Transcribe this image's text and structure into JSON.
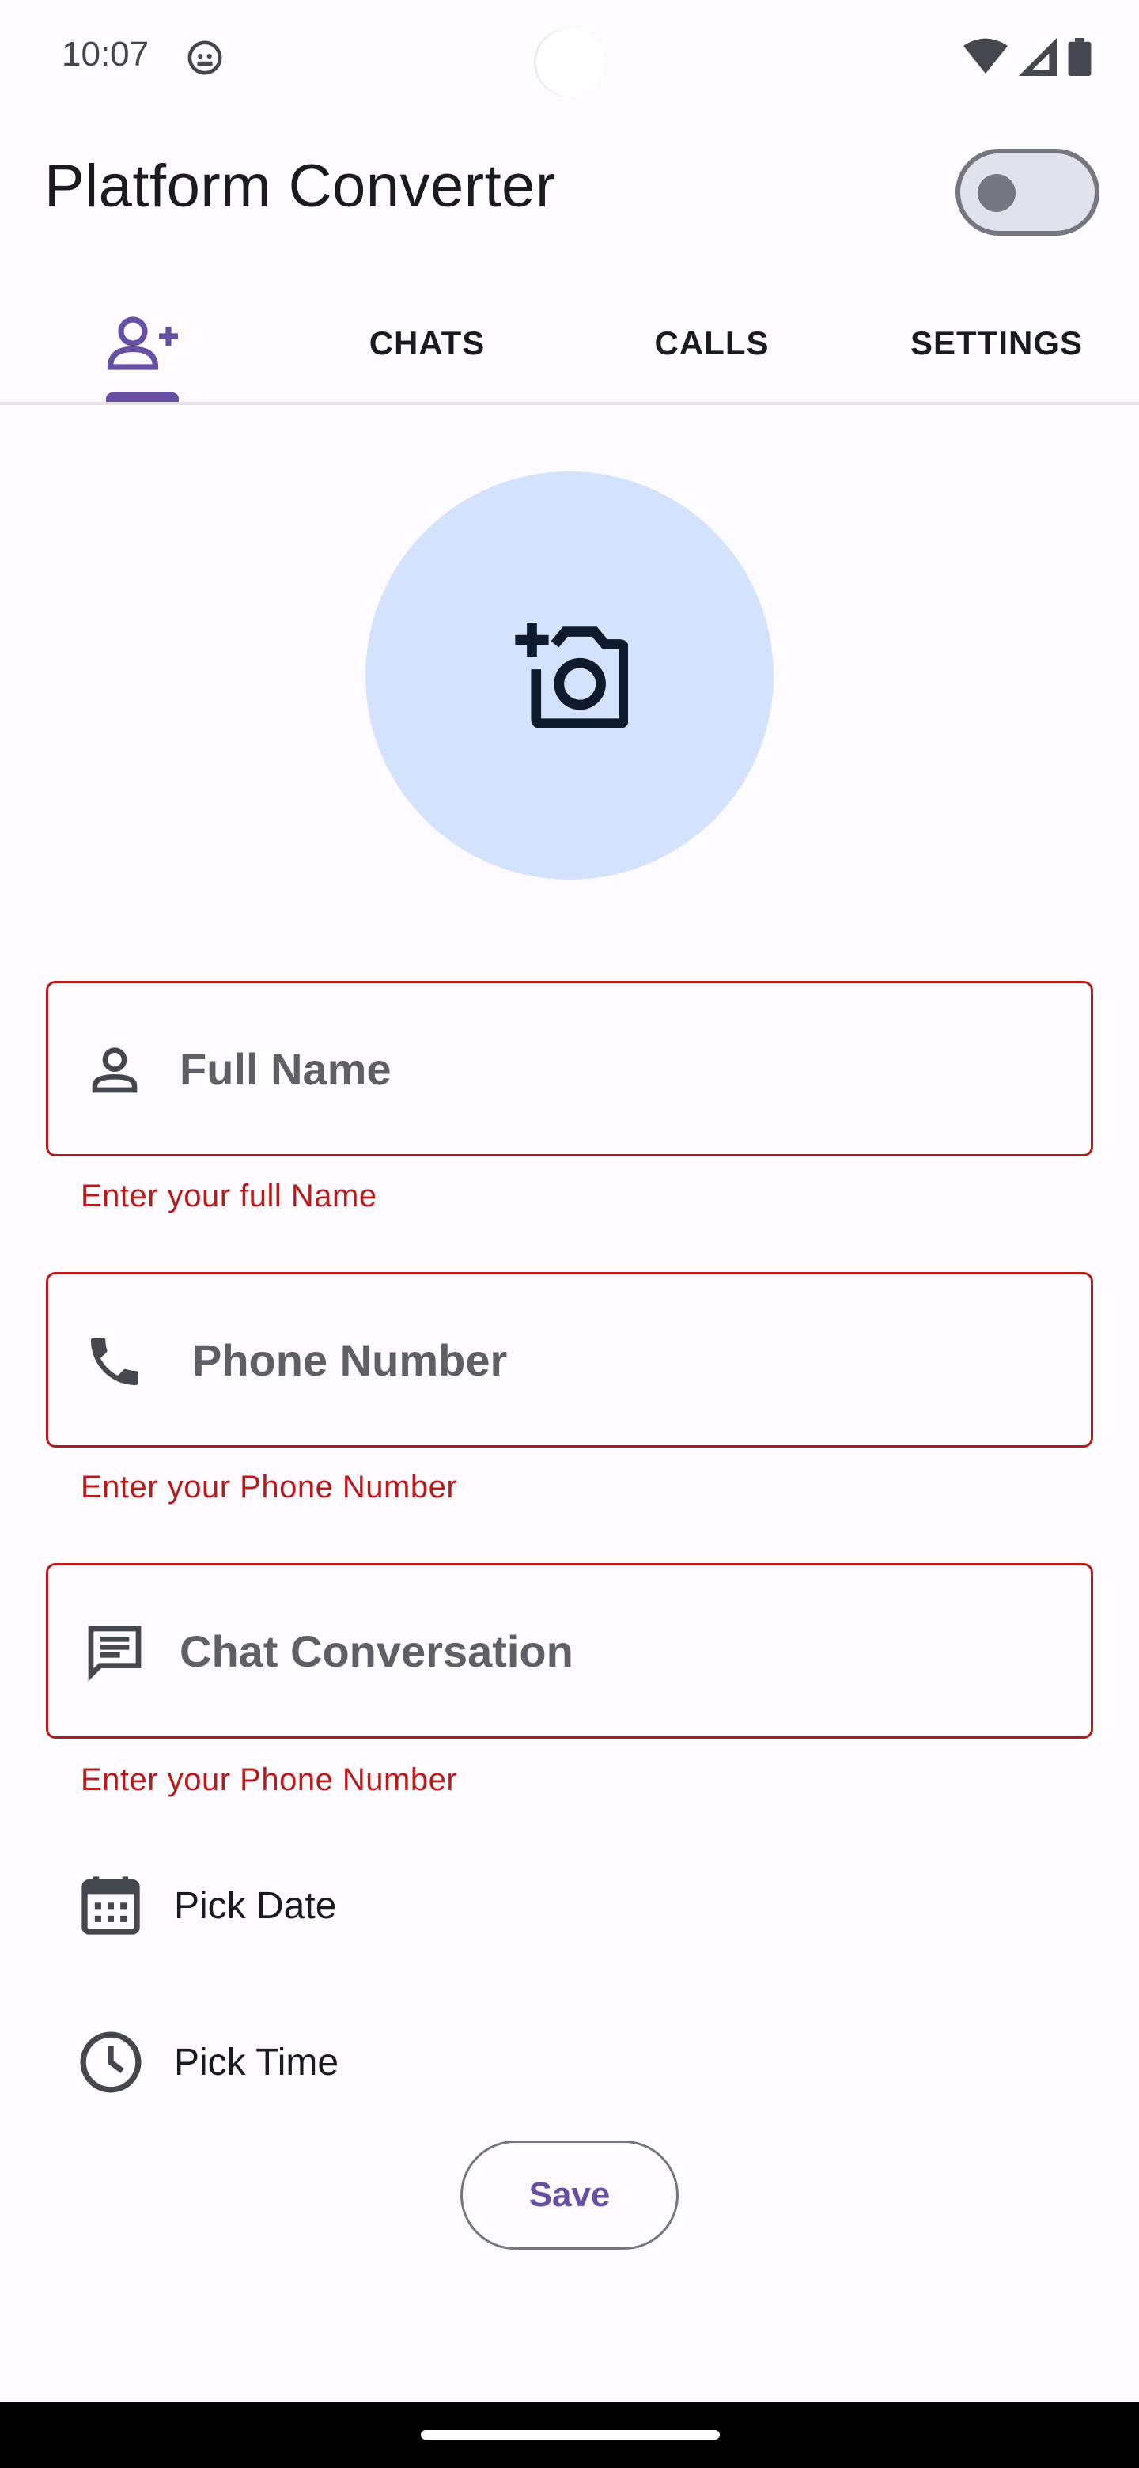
{
  "status_bar": {
    "time": "10:07",
    "icons": [
      "robot-notification-icon",
      "wifi-icon",
      "cell-signal-icon",
      "battery-icon"
    ]
  },
  "app_bar": {
    "title": "Platform Converter",
    "toggle_state": "off"
  },
  "tabs": [
    {
      "label": "",
      "icon": "person-add-icon",
      "selected": true
    },
    {
      "label": "CHATS",
      "selected": false
    },
    {
      "label": "CALLS",
      "selected": false
    },
    {
      "label": "SETTINGS",
      "selected": false
    }
  ],
  "avatar": {
    "icon": "add-photo-camera-icon"
  },
  "form": {
    "full_name": {
      "placeholder": "Full Name",
      "error": "Enter your full Name",
      "icon": "person-icon"
    },
    "phone": {
      "placeholder": "Phone Number",
      "error": "Enter your Phone Number",
      "icon": "phone-icon"
    },
    "chat": {
      "placeholder": "Chat Conversation",
      "error": "Enter your Phone Number",
      "icon": "chat-icon"
    },
    "pick_date": {
      "label": "Pick Date",
      "icon": "calendar-icon"
    },
    "pick_time": {
      "label": "Pick Time",
      "icon": "clock-icon"
    },
    "save_label": "Save"
  },
  "colors": {
    "primary": "#6750a4",
    "error": "#ba1a1a",
    "avatar_bg": "#d3e3fd",
    "background": "#fdfbff"
  }
}
